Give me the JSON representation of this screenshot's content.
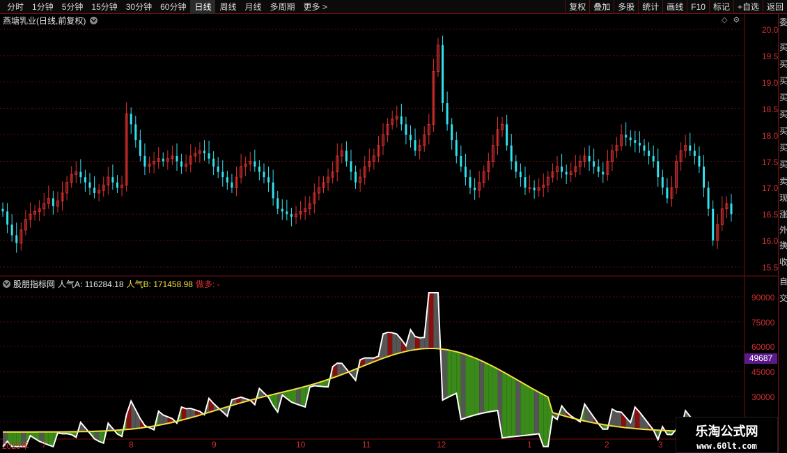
{
  "toolbar": {
    "period_tabs": [
      "分时",
      "1分钟",
      "5分钟",
      "15分钟",
      "30分钟",
      "60分钟",
      "日线",
      "周线",
      "月线",
      "多周期",
      "更多 >"
    ],
    "active_tab": "日线",
    "buttons": [
      "复权",
      "叠加",
      "多股",
      "统计",
      "画线",
      "F10",
      "标记",
      "+自选",
      "返回"
    ]
  },
  "main_chart": {
    "title": "燕塘乳业(日线,前复权)",
    "price_axis": [
      "20.00",
      "19.50",
      "19.00",
      "18.50",
      "18.00",
      "17.50",
      "17.00",
      "16.50",
      "16.00",
      "15.50"
    ],
    "up_color": "#e03030",
    "down_color": "#33e0ee"
  },
  "indicator": {
    "name": "股朋指标网",
    "a_label": "人气A: 116284.18",
    "b_label": "人气B: 171458.98",
    "c_label": "做多: -",
    "axis": [
      "90000",
      "75000",
      "60000",
      "45000",
      "30000"
    ],
    "current_value": "49687"
  },
  "dates": [
    "2025年",
    "7",
    "8",
    "9",
    "10",
    "11",
    "12",
    "1",
    "2",
    "3"
  ],
  "edge_chars": [
    "委",
    "买",
    "买",
    "买",
    "买",
    "买",
    "买",
    "买",
    "买",
    "卖",
    "现",
    "涨",
    "外",
    "换",
    "收",
    "自",
    "交"
  ],
  "watermark": {
    "title": "乐淘公式网",
    "url": "www.60lt.com"
  },
  "chart_data": {
    "type": "candlestick",
    "ylim_price": [
      15.4,
      20.1
    ],
    "candles_note": "daily candles Jul 2025 - Mar 2026",
    "closes": [
      16.55,
      16.3,
      16.1,
      15.95,
      16.2,
      16.4,
      16.5,
      16.55,
      16.6,
      16.7,
      16.8,
      16.65,
      16.75,
      16.9,
      17.1,
      17.25,
      17.3,
      17.2,
      17.1,
      17.0,
      16.9,
      16.95,
      17.05,
      17.2,
      17.1,
      17.0,
      17.05,
      18.4,
      18.2,
      17.9,
      17.6,
      17.4,
      17.45,
      17.5,
      17.55,
      17.5,
      17.55,
      17.6,
      17.5,
      17.4,
      17.45,
      17.6,
      17.65,
      17.7,
      17.65,
      17.55,
      17.4,
      17.3,
      17.2,
      17.1,
      17.0,
      17.2,
      17.4,
      17.45,
      17.5,
      17.4,
      17.3,
      17.2,
      17.1,
      16.8,
      16.6,
      16.55,
      16.5,
      16.45,
      16.5,
      16.55,
      16.6,
      16.7,
      16.9,
      17.0,
      17.1,
      17.2,
      17.3,
      17.6,
      17.7,
      17.5,
      17.3,
      17.1,
      17.2,
      17.4,
      17.5,
      17.6,
      17.8,
      18.0,
      18.2,
      18.3,
      18.35,
      18.2,
      18.0,
      17.9,
      17.7,
      17.8,
      18.0,
      18.2,
      19.2,
      19.7,
      18.6,
      18.2,
      17.9,
      17.6,
      17.4,
      17.2,
      17.0,
      16.95,
      17.1,
      17.3,
      17.5,
      17.8,
      18.1,
      18.2,
      17.8,
      17.5,
      17.3,
      17.2,
      17.0,
      17.0,
      16.95,
      17.0,
      17.05,
      17.2,
      17.3,
      17.4,
      17.3,
      17.25,
      17.3,
      17.4,
      17.5,
      17.6,
      17.5,
      17.4,
      17.3,
      17.25,
      17.5,
      17.7,
      17.8,
      18.0,
      17.95,
      17.9,
      17.85,
      17.8,
      17.7,
      17.6,
      17.5,
      17.2,
      17.0,
      16.8,
      17.0,
      17.5,
      17.7,
      17.8,
      17.7,
      17.6,
      17.4,
      17.0,
      16.6,
      16.0,
      16.3,
      16.6,
      16.7,
      16.5
    ]
  }
}
